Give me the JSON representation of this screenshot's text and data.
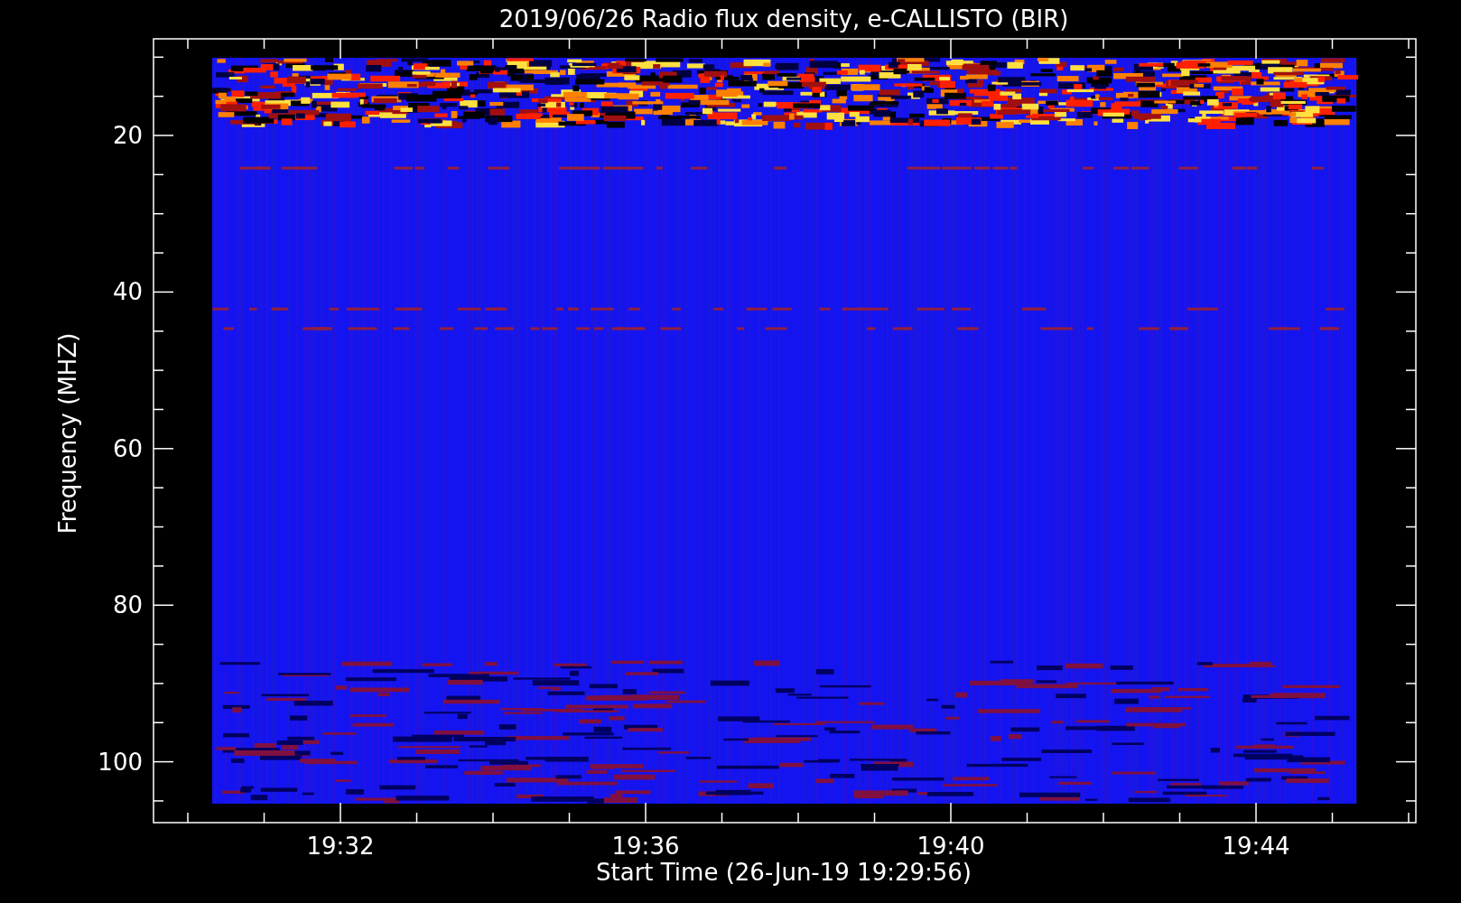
{
  "title": "2019/06/26  Radio flux density, e-CALLISTO (BIR)",
  "y_axis": {
    "label": "Frequency (MHZ)",
    "ticks": [
      "20",
      "40",
      "60",
      "80",
      "100"
    ]
  },
  "x_axis": {
    "label": "Start Time (26-Jun-19 19:29:56)",
    "ticks": [
      "19:32",
      "19:36",
      "19:40",
      "19:44"
    ]
  }
}
